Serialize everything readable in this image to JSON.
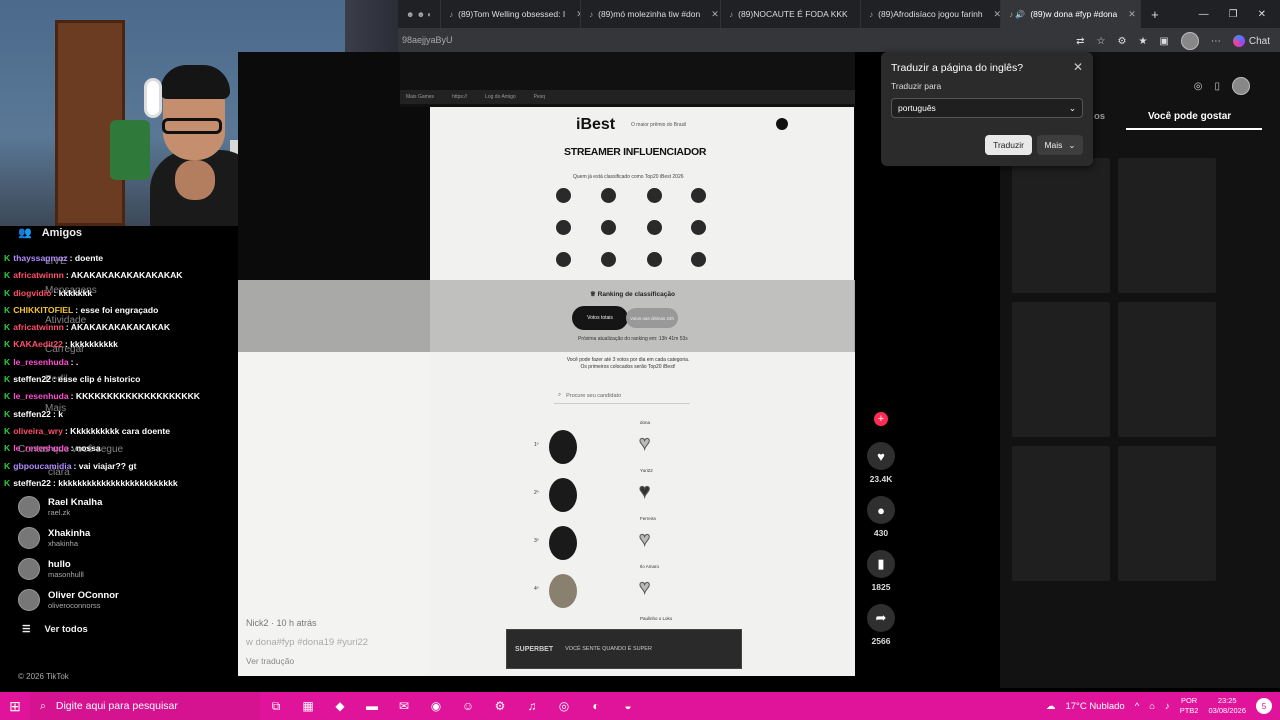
{
  "browser": {
    "tabs": [
      {
        "label": "(89)Tom Welling obsessed: I"
      },
      {
        "label": "(89)mó molezinha tiw #don"
      },
      {
        "label": "(89)NOCAUTE É FODA KKK"
      },
      {
        "label": "(89)Afrodisíaco jogou farinh"
      },
      {
        "label": "(89)w dona #fyp #dona"
      }
    ],
    "new_tab": "+",
    "address": "98aejjyaByU",
    "chat_label": "Chat"
  },
  "translate_popup": {
    "title": "Traduzir a página do inglês?",
    "target_label": "Traduzir para",
    "selected_language": "português",
    "translate_button": "Traduzir",
    "more_button": "Mais"
  },
  "stream_chat": [
    {
      "user": "thayssagmoz",
      "msg": ": doente",
      "color": "#b18cff"
    },
    {
      "user": "africatwinnn",
      "msg": ": AKAKAKAKAKAKAKAKAK",
      "color": "#ff4f6b"
    },
    {
      "user": "diogvidio",
      "msg": ": kkkkkkk",
      "color": "#ff4f6b"
    },
    {
      "user": "CHIKKITOFIEL",
      "msg": ": esse foi engraçado",
      "color": "#f4c430"
    },
    {
      "user": "africatwinnn",
      "msg": ": AKAKAKAKAKAKAKAK",
      "color": "#ff4f6b"
    },
    {
      "user": "KAKAedit22",
      "msg": ": kkkkkkkkkk",
      "color": "#ff4f6b"
    },
    {
      "user": "le_resenhuda",
      "msg": ": .",
      "color": "#ff4fd2"
    },
    {
      "user": "steffen22",
      "msg": ": esse clip é historico",
      "color": "#ffffff"
    },
    {
      "user": "le_resenhuda",
      "msg": ": KKKKKKKKKKKKKKKKKKKK",
      "color": "#ff4fd2"
    },
    {
      "user": "steffen22",
      "msg": ": k",
      "color": "#ffffff"
    },
    {
      "user": "oliveira_wry",
      "msg": ": Kkkkkkkkkk cara doente",
      "color": "#ff4f6b"
    },
    {
      "user": "le_resenhuda",
      "msg": ": nossa",
      "color": "#ff4fd2"
    },
    {
      "user": "gbpoucamidia",
      "msg": ": vai viajar?? gt",
      "color": "#b18cff"
    },
    {
      "user": "steffen22",
      "msg": ": kkkkkkkkkkkkkkkkkkkkkkkkk",
      "color": "#ffffff"
    }
  ],
  "tiktok_sidebar": {
    "friends_label": "Amigos",
    "ghost_live": "LIVE",
    "ghost_messages": "Mensagens",
    "ghost_activity": "Atividade",
    "ghost_upload": "Carregar",
    "ghost_profile": "Perfil",
    "ghost_more": "Mais",
    "ghost_following": "Contas que você segue",
    "ghost_clara": "clara",
    "accounts": [
      {
        "name": "Rael Knalha",
        "handle": "rael.zk"
      },
      {
        "name": "Xhakinha",
        "handle": "xhakinha"
      },
      {
        "name": "hullo",
        "handle": "masonhulll"
      },
      {
        "name": "Oliver OConnor",
        "handle": "oliveroconnorss"
      }
    ],
    "see_all": "Ver todos",
    "copyright": "© 2026 TikTok"
  },
  "video": {
    "ibest_logo": "iBest",
    "ibest_logo_sub": "O maior prêmio do Brasil",
    "category_title": "STREAMER INFLUENCIADOR",
    "category_sub": "Quem já está classificado como Top20 iBest 2026",
    "ranking_title": "Ranking de classificação",
    "pill_votes": "Votos totais",
    "pill_votes_today": "Votos nas últimas 24h",
    "rank_note": "Próxima atualização do ranking em: 13h 41m 53s",
    "vote_note": "Você pode fazer até 3 votos por dia em cada categoria. Os primeiros colocados serão Top20 iBest!",
    "search_placeholder": "Procure seu candidato",
    "ranking": [
      {
        "pos": "1º",
        "name": "dona"
      },
      {
        "pos": "2º",
        "name": "Yuri22"
      },
      {
        "pos": "3º",
        "name": "Ferreira"
      },
      {
        "pos": "4º",
        "name": "Ilo Amaro"
      }
    ],
    "next_rank_name": "Paulinho o Loko",
    "faint_user": "Nick2 · 10 h atrás",
    "caption": "w dona#fyp #dona19 #yuri22",
    "see_translation": "Ver tradução",
    "ad_brand": "SUPERBET",
    "ad_text": "VOCÊ SENTE QUANDO É SUPER",
    "progress": 0.05,
    "accent_color": "#fe2c55"
  },
  "actions": {
    "likes": "23.4K",
    "comments": "430",
    "saves": "1825",
    "shares": "2566"
  },
  "right_panel": {
    "tab_partial": "os",
    "tab_active": "Você pode gostar"
  },
  "taskbar": {
    "search_placeholder": "Digite aqui para pesquisar",
    "weather": "17°C  Nublado",
    "lang_top": "POR",
    "lang_bottom": "PTB2",
    "time": "23:25",
    "date": "03/08/2026",
    "notifications": "5"
  }
}
